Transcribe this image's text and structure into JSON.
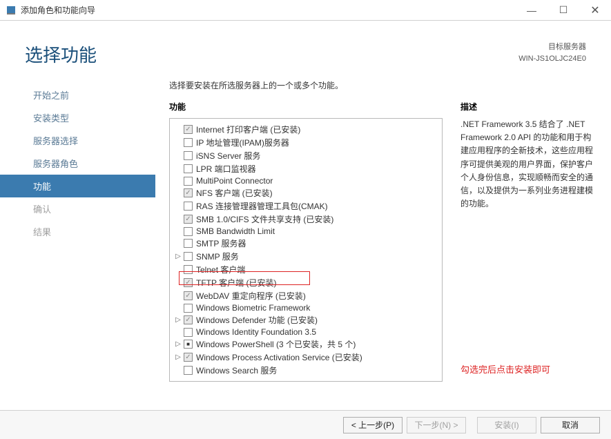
{
  "window": {
    "title": "添加角色和功能向导",
    "min": "—",
    "max": "☐",
    "close": "✕"
  },
  "header": {
    "pageTitle": "选择功能",
    "targetLabel": "目标服务器",
    "targetName": "WIN-JS1OLJC24E0"
  },
  "sidebar": {
    "items": [
      {
        "label": "开始之前",
        "state": "normal"
      },
      {
        "label": "安装类型",
        "state": "normal"
      },
      {
        "label": "服务器选择",
        "state": "normal"
      },
      {
        "label": "服务器角色",
        "state": "normal"
      },
      {
        "label": "功能",
        "state": "active"
      },
      {
        "label": "确认",
        "state": "disabled"
      },
      {
        "label": "结果",
        "state": "disabled"
      }
    ]
  },
  "main": {
    "instruction": "选择要安装在所选服务器上的一个或多个功能。",
    "featuresLabel": "功能",
    "descLabel": "描述",
    "description": ".NET Framework 3.5 结合了 .NET Framework 2.0 API 的功能和用于构建应用程序的全新技术，这些应用程序可提供美观的用户界面，保护客户个人身份信息，实现顺畅而安全的通信，以及提供为一系列业务进程建模的功能。",
    "annotation": "勾选完后点击安装即可",
    "features": [
      {
        "exp": "",
        "cb": "checked-disabled",
        "label": "Internet 打印客户端 (已安装)"
      },
      {
        "exp": "",
        "cb": "",
        "label": "IP 地址管理(IPAM)服务器"
      },
      {
        "exp": "",
        "cb": "",
        "label": "iSNS Server 服务"
      },
      {
        "exp": "",
        "cb": "",
        "label": "LPR 端口监视器"
      },
      {
        "exp": "",
        "cb": "",
        "label": "MultiPoint Connector"
      },
      {
        "exp": "",
        "cb": "checked-disabled",
        "label": "NFS 客户端 (已安装)"
      },
      {
        "exp": "",
        "cb": "",
        "label": "RAS 连接管理器管理工具包(CMAK)"
      },
      {
        "exp": "",
        "cb": "checked-disabled",
        "label": "SMB 1.0/CIFS 文件共享支持 (已安装)"
      },
      {
        "exp": "",
        "cb": "",
        "label": "SMB Bandwidth Limit"
      },
      {
        "exp": "",
        "cb": "",
        "label": "SMTP 服务器"
      },
      {
        "exp": "▷",
        "cb": "",
        "label": "SNMP 服务"
      },
      {
        "exp": "",
        "cb": "",
        "label": "Telnet 客户端"
      },
      {
        "exp": "",
        "cb": "checked-disabled",
        "label": "TFTP 客户端 (已安装)"
      },
      {
        "exp": "",
        "cb": "checked-disabled",
        "label": "WebDAV 重定向程序 (已安装)"
      },
      {
        "exp": "",
        "cb": "",
        "label": "Windows Biometric Framework"
      },
      {
        "exp": "▷",
        "cb": "checked-disabled",
        "label": "Windows Defender 功能 (已安装)"
      },
      {
        "exp": "",
        "cb": "",
        "label": "Windows Identity Foundation 3.5"
      },
      {
        "exp": "▷",
        "cb": "square",
        "label": "Windows PowerShell (3 个已安装，共 5 个)"
      },
      {
        "exp": "▷",
        "cb": "checked-disabled",
        "label": "Windows Process Activation Service (已安装)"
      },
      {
        "exp": "",
        "cb": "",
        "label": "Windows Search 服务"
      }
    ]
  },
  "footer": {
    "prev": "< 上一步(P)",
    "next": "下一步(N) >",
    "install": "安装(I)",
    "cancel": "取消"
  }
}
